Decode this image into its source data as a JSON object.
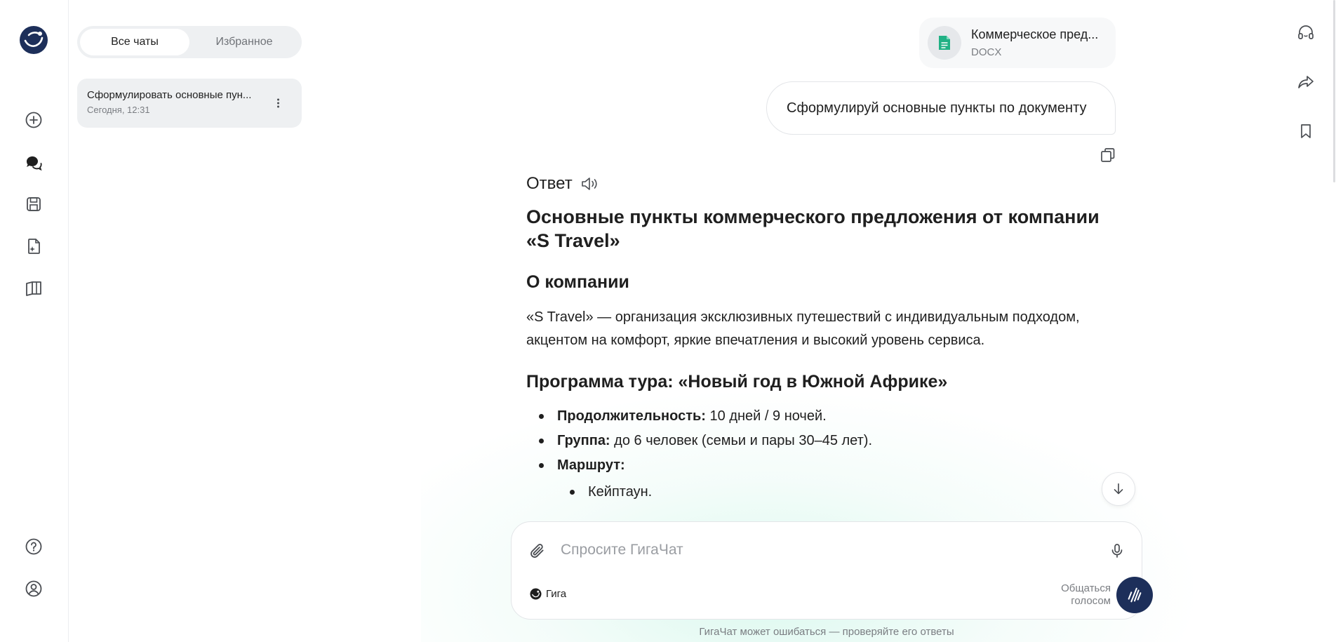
{
  "colors": {
    "accent": "#1d2f5a",
    "file_icon": "#21b185",
    "muted_text": "#7a7d82"
  },
  "rail": {
    "icons": [
      "gigachat-logo",
      "new-chat-icon",
      "chats-icon",
      "saved-icon",
      "document-ai-icon",
      "book-icon",
      "help-icon",
      "profile-icon"
    ]
  },
  "chats_panel": {
    "tabs": [
      {
        "label": "Все чаты",
        "active": true
      },
      {
        "label": "Избранное",
        "active": false
      }
    ],
    "items": [
      {
        "title": "Сформулировать основные пун...",
        "time": "Сегодня, 12:31"
      }
    ]
  },
  "attachment": {
    "name": "Коммерческое пред...",
    "type": "DOCX"
  },
  "user_message": "Сформулируй основные пункты по документу",
  "answer": {
    "label": "Ответ",
    "title": "Основные пункты коммерческого предложения от компании «S Travel»",
    "about_heading": "О компании",
    "about_text": "«S Travel» — организация эксклюзивных путешествий с индивидуальным подходом, акцентом на комфорт, яркие впечатления и высокий уровень сервиса.",
    "program_heading": "Программа тура: «Новый год в Южной Африке»",
    "items": [
      {
        "label": "Продолжительность:",
        "value": " 10 дней / 9 ночей."
      },
      {
        "label": "Группа:",
        "value": " до 6 человек (семьи и пары 30–45 лет)."
      },
      {
        "label": "Маршрут:",
        "value": ""
      }
    ],
    "subitems": [
      "Кейптаун."
    ]
  },
  "composer": {
    "placeholder": "Спросите ГигаЧат",
    "model_label": "Гига",
    "voice_label_line1": "Общаться",
    "voice_label_line2": "голосом"
  },
  "disclaimer": "ГигаЧат может ошибаться — проверяйте его ответы"
}
